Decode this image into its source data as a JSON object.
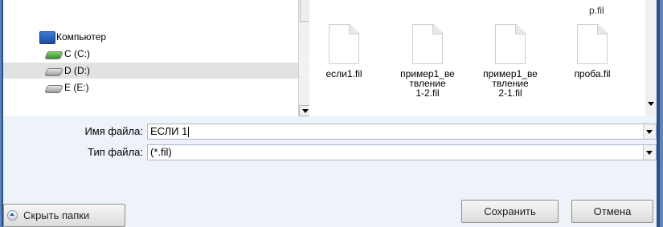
{
  "nav": {
    "items": [
      {
        "label": "Компьютер",
        "icon": "computer-icon",
        "selected": false
      },
      {
        "label": "C (C:)",
        "icon": "drive-c-icon",
        "selected": false
      },
      {
        "label": "D (D:)",
        "icon": "drive-icon",
        "selected": true
      },
      {
        "label": "E (E:)",
        "icon": "drive-icon",
        "selected": false
      }
    ]
  },
  "files": {
    "top_partial_label": "р.fil",
    "items": [
      {
        "name": "если1.fil"
      },
      {
        "name": "пример1_ве\nтвление\n1-2.fil"
      },
      {
        "name": "пример1_ве\nтвление\n2-1.fil"
      },
      {
        "name": "проба.fil"
      }
    ]
  },
  "form": {
    "filename_label": "Имя файла:",
    "filename_value": "ЕСЛИ 1",
    "filetype_label": "Тип файла:",
    "filetype_value": "(*.fil)"
  },
  "buttons": {
    "hide_folders": "Скрыть папки",
    "save": "Сохранить",
    "cancel": "Отмена"
  }
}
